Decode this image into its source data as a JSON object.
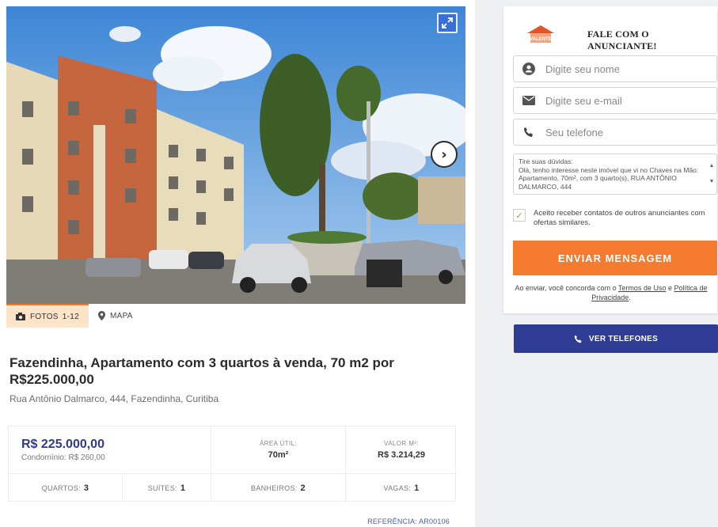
{
  "listing": {
    "tabs": [
      {
        "label": "FOTOS",
        "count": "1-12"
      },
      {
        "label": "MAPA"
      }
    ],
    "title": "Fazendinha, Apartamento com 3 quartos à venda, 70 m2 por R$225.000,00",
    "address": "Rua Antônio Dalmarco, 444, Fazendinha, Curitiba",
    "price": "R$ 225.000,00",
    "condo": "Condomínio: R$ 260,00",
    "area_label": "ÁREA ÚTIL:",
    "area_value": "70m²",
    "sqm_label": "VALOR M²:",
    "sqm_value": "R$ 3.214,29",
    "features": [
      {
        "label": "QUARTOS:",
        "value": "3"
      },
      {
        "label": "SUÍTES:",
        "value": "1"
      },
      {
        "label": "BANHEIROS:",
        "value": "2"
      },
      {
        "label": "VAGAS:",
        "value": "1"
      }
    ],
    "reference": "REFERÊNCIA: AR00106"
  },
  "contact": {
    "logo_text": "VALENTE",
    "title": "FALE COM O ANUNCIANTE!",
    "name_placeholder": "Digite seu nome",
    "email_placeholder": "Digite seu e-mail",
    "phone_placeholder": "Seu telefone",
    "message_title": "Tire suas dúvidas:",
    "message_text": "Olá, tenho interesse neste imóvel que vi no Chaves na Mão: Apartamento, 70m², com 3 quarto(s), RUA ANTÔNIO DALMARCO, 444",
    "consent_text": "Aceito receber contatos de outros anunciantes com ofertas similares.",
    "send_label": "ENVIAR MENSAGEM",
    "terms_prefix": "Ao enviar, você concorda com o ",
    "terms_link": "Termos de Uso",
    "terms_and": " e ",
    "privacy_link": "Política de Privacidade",
    "terms_suffix": ".",
    "phones_label": "VER TELEFONES"
  },
  "colors": {
    "accent": "#f57c2f",
    "navy": "#2e3c93",
    "price": "#2e3a8c"
  }
}
